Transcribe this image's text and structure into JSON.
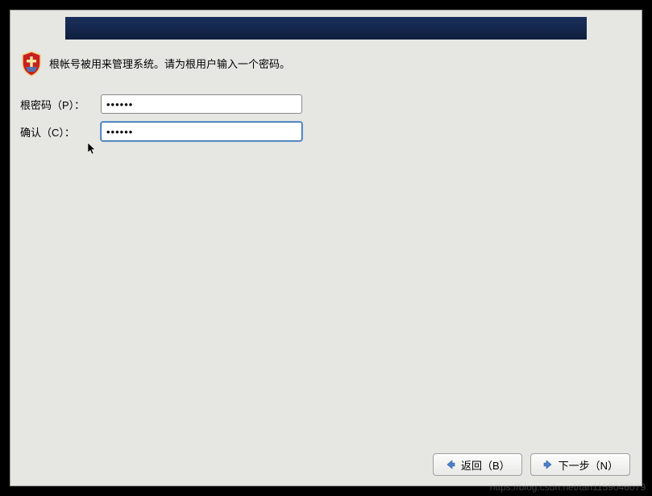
{
  "instruction": "根帐号被用来管理系统。请为根用户输入一个密码。",
  "form": {
    "password_label": "根密码（P）：",
    "password_value": "••••••",
    "confirm_label": "确认（C）：",
    "confirm_value": "••••••"
  },
  "buttons": {
    "back_label": "返回（B）",
    "next_label": "下一步（N）"
  },
  "icons": {
    "shield": "shield-icon",
    "arrow_left": "arrow-left-icon",
    "arrow_right": "arrow-right-icon"
  },
  "colors": {
    "header_bg": "#14295a",
    "window_bg": "#e6e6e3",
    "arrow_blue": "#4a7fc7"
  },
  "watermark": "https://blog.csdn.net/tan1159046079"
}
